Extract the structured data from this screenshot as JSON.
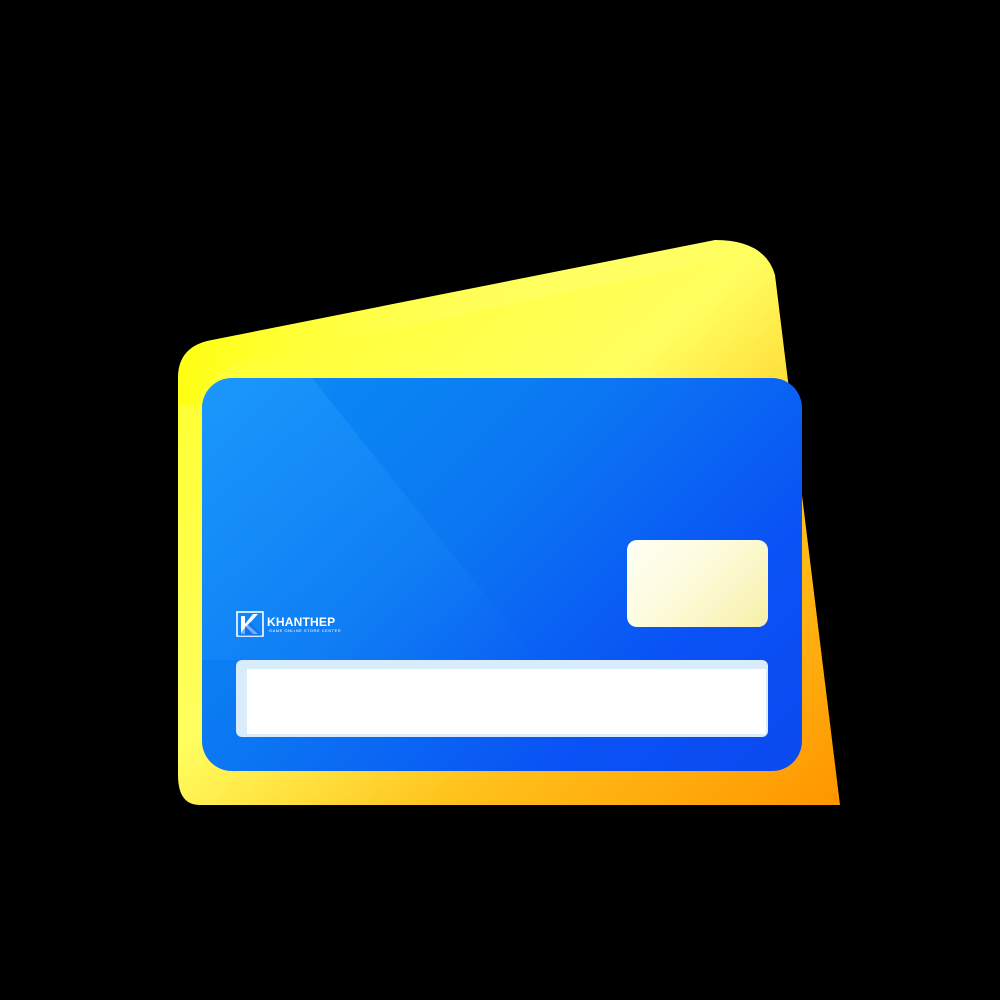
{
  "brand": {
    "name": "KHANTHEP",
    "tagline": "GAME ONLINE STORE CENTER"
  },
  "colors": {
    "background": "#000000",
    "back_card_yellow": "#ffff1e",
    "back_card_orange": "#ff9f00",
    "front_card_blue": "#0b6cf3",
    "chip_cream": "#fdfbdc",
    "stripe_white": "#ffffff"
  },
  "icons": {
    "brand_logo": "khanthep-logo-icon"
  }
}
